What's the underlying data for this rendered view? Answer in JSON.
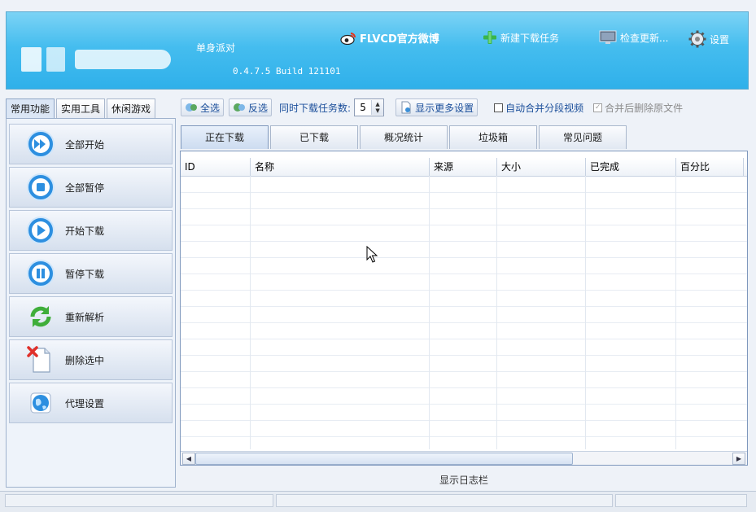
{
  "header": {
    "username": "单身派对",
    "version": "0.4.7.5 Build 121101",
    "weibo_label": "FLVCD官方微博",
    "new_task_label": "新建下载任务",
    "check_update_label": "检查更新...",
    "settings_label": "设置"
  },
  "left_tabs": [
    "常用功能",
    "实用工具",
    "休闲游戏"
  ],
  "left_buttons": [
    {
      "label": "全部开始",
      "icon": "fast-forward-icon"
    },
    {
      "label": "全部暂停",
      "icon": "stop-icon"
    },
    {
      "label": "开始下载",
      "icon": "play-icon"
    },
    {
      "label": "暂停下载",
      "icon": "pause-icon"
    },
    {
      "label": "重新解析",
      "icon": "refresh-icon"
    },
    {
      "label": "删除选中",
      "icon": "delete-file-icon"
    },
    {
      "label": "代理设置",
      "icon": "globe-icon"
    }
  ],
  "toolbar": {
    "select_all": "全选",
    "invert": "反选",
    "concurrent_label": "同时下载任务数:",
    "concurrent_value": "5",
    "more_settings": "显示更多设置",
    "auto_merge": "自动合并分段视频",
    "auto_merge_checked": false,
    "delete_after_merge": "合并后删除原文件",
    "delete_after_merge_checked": true
  },
  "main_tabs": [
    "正在下载",
    "已下载",
    "概况统计",
    "垃圾箱",
    "常见问题"
  ],
  "table": {
    "columns": [
      "ID",
      "名称",
      "来源",
      "大小",
      "已完成",
      "百分比"
    ],
    "rows": []
  },
  "log_bar_label": "显示日志栏",
  "colors": {
    "header_top": "#7cd3f5",
    "header_bottom": "#2fb0ea",
    "link_blue": "#1a4e9a",
    "panel_bg": "#eef3fa"
  }
}
